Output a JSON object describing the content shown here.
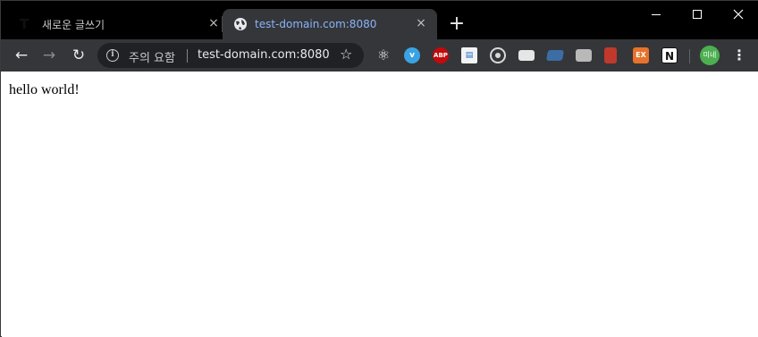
{
  "tabs": [
    {
      "title": "새로운 글쓰기",
      "logo": "T",
      "close": "×"
    },
    {
      "title": "test-domain.com:8080",
      "close": "×"
    }
  ],
  "new_tab_label": "+",
  "toolbar": {
    "back": "←",
    "forward": "→",
    "reload": "↻",
    "security_label": "주의 요함",
    "url": "test-domain.com:8080",
    "star": "☆",
    "menu": "⋮",
    "avatar_text": "미네"
  },
  "extensions": {
    "react": "⚛",
    "abp": "ABP",
    "ex": "EX",
    "notion": "N"
  },
  "page": {
    "content": "hello world!"
  },
  "colors": {
    "tab_active_text": "#8ab4f8",
    "toolbar_bg": "#35363a",
    "omnibox_bg": "#202124",
    "avatar_bg": "#4caf50"
  }
}
